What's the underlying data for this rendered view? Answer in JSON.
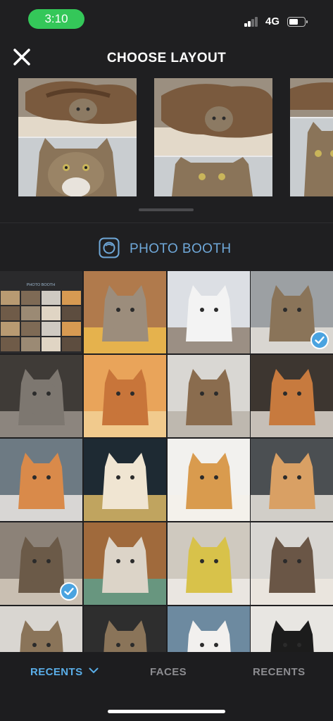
{
  "status_bar": {
    "time": "3:10",
    "network": "4G"
  },
  "header": {
    "title": "CHOOSE LAYOUT"
  },
  "photo_booth": {
    "label": "PHOTO BOOTH"
  },
  "first_cell": {
    "label": "PHOTO BOOTH"
  },
  "tabs": [
    {
      "label": "RECENTS",
      "active": true
    },
    {
      "label": "FACES",
      "active": false
    },
    {
      "label": "RECENTS",
      "active": false
    }
  ],
  "colors": {
    "accent": "#4aa3e0",
    "status_green": "#34c759",
    "background": "#1f1f21"
  },
  "photos": [
    {
      "subject": "photo-booth-collage"
    },
    {
      "subject": "tabby-cat-yellow-bandana"
    },
    {
      "subject": "cat-under-blanket"
    },
    {
      "subject": "tabby-cat-portrait",
      "selected": true
    },
    {
      "subject": "cat-sleeping-on-wood"
    },
    {
      "subject": "orange-cat-back"
    },
    {
      "subject": "tabby-cat-on-bed"
    },
    {
      "subject": "calico-cat-looking-up"
    },
    {
      "subject": "orange-cat-sitting-street"
    },
    {
      "subject": "cat-with-fairy-lights"
    },
    {
      "subject": "orange-cat-closeup"
    },
    {
      "subject": "cat-lying-on-floor"
    },
    {
      "subject": "cat-under-pillow",
      "selected": true
    },
    {
      "subject": "cat-lying-on-table"
    },
    {
      "subject": "cat-sitting-on-sofa"
    },
    {
      "subject": "siamese-cat"
    },
    {
      "subject": "tabby-cat-closeup"
    },
    {
      "subject": "tabby-cat-head"
    },
    {
      "subject": "surprised-white-cat"
    },
    {
      "subject": "black-cat-kitchen"
    }
  ]
}
